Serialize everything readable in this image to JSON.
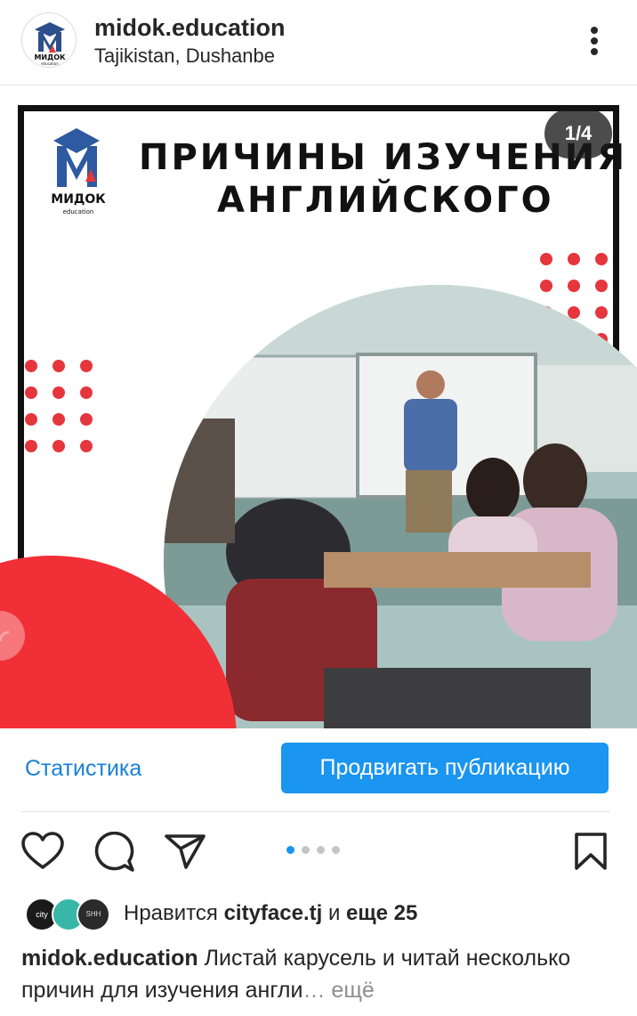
{
  "header": {
    "username": "midok.education",
    "location": "Tajikistan, Dushanbe",
    "avatar_icon": "midok-logo-icon",
    "more_icon": "more-vertical-icon",
    "logo_text": "МИДОК",
    "logo_subtext": "education"
  },
  "post": {
    "counter": "1/4",
    "title_line1": "ПРИЧИНЫ ИЗУЧЕНИЯ",
    "title_line2": "АНГЛИЙСКОГО",
    "logo_text": "МИДОК",
    "logo_subtext": "education",
    "accent_color": "#f12f36",
    "audio_icon": "headphones-icon"
  },
  "actions": {
    "stats_label": "Статистика",
    "promote_label": "Продвигать публикацию",
    "like_icon": "heart-icon",
    "comment_icon": "comment-icon",
    "share_icon": "send-icon",
    "save_icon": "bookmark-icon",
    "carousel_pages": 4,
    "carousel_active": 1
  },
  "likes": {
    "prefix": "Нравится",
    "user": "cityface.tj",
    "and": "и",
    "others": "еще 25",
    "liker_labels": [
      "city",
      "",
      "SHH"
    ]
  },
  "caption": {
    "user": "midok.education",
    "text": "Листай карусель и читай несколько причин для изучения англи",
    "ellipsis": "…",
    "more": "ещё"
  }
}
